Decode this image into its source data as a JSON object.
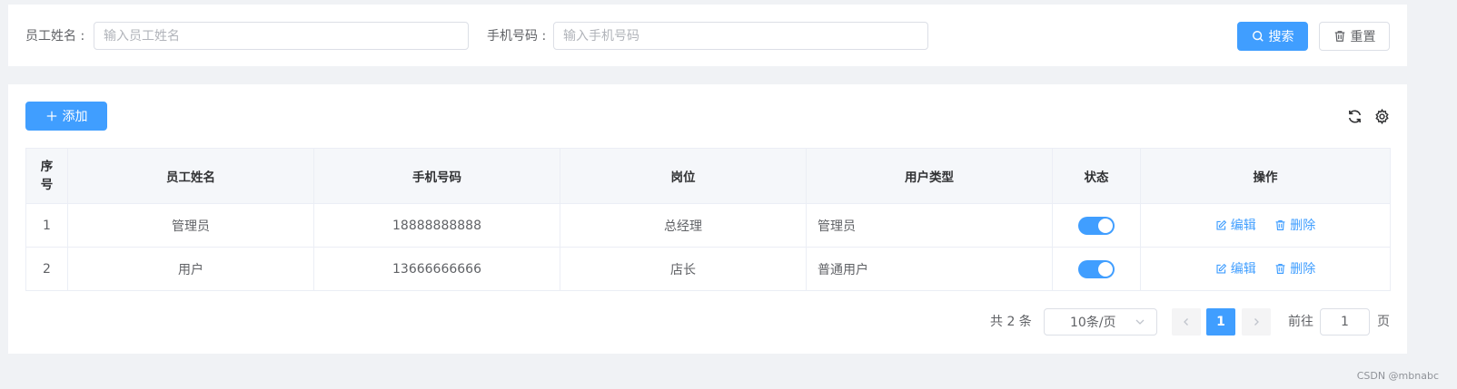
{
  "search": {
    "name_label": "员工姓名 :",
    "name_placeholder": "输入员工姓名",
    "name_value": "",
    "phone_label": "手机号码 :",
    "phone_placeholder": "输入手机号码",
    "phone_value": "",
    "search_label": "搜索",
    "reset_label": "重置"
  },
  "toolbar": {
    "add_label": "添加"
  },
  "table": {
    "headers": {
      "index_a": "序",
      "index_b": "号",
      "name": "员工姓名",
      "phone": "手机号码",
      "position": "岗位",
      "user_type": "用户类型",
      "status": "状态",
      "actions": "操作"
    },
    "rows": [
      {
        "index": "1",
        "name": "管理员",
        "phone": "18888888888",
        "position": "总经理",
        "user_type": "管理员",
        "status_on": true,
        "edit": "编辑",
        "delete": "删除"
      },
      {
        "index": "2",
        "name": "用户",
        "phone": "13666666666",
        "position": "店长",
        "user_type": "普通用户",
        "status_on": true,
        "edit": "编辑",
        "delete": "删除"
      }
    ]
  },
  "pagination": {
    "total_text": "共 2 条",
    "page_size": "10条/页",
    "current_page": "1",
    "goto_prefix": "前往",
    "goto_value": "1",
    "goto_suffix": "页"
  },
  "watermark": "CSDN @mbnabc",
  "colors": {
    "primary": "#409eff",
    "page_bg": "#f0f2f5"
  },
  "icons": {
    "search": "search-icon",
    "reset": "trash-icon",
    "add": "plus-icon",
    "refresh": "refresh-icon",
    "settings": "gear-icon",
    "edit": "edit-icon",
    "delete": "trash-icon"
  }
}
